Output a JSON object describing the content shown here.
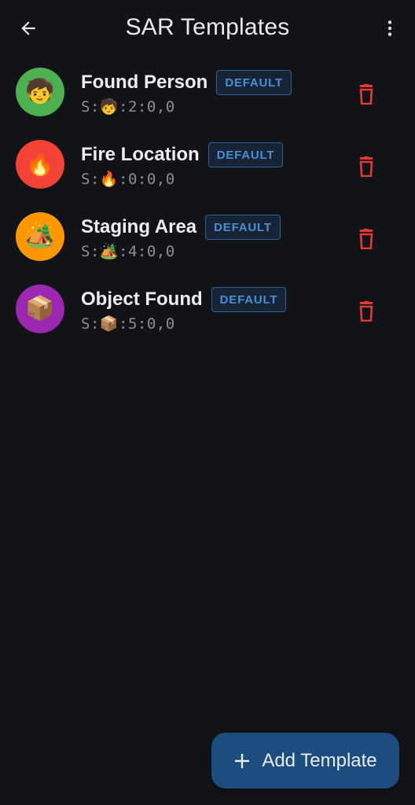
{
  "appbar": {
    "title": "SAR Templates",
    "back_icon": "arrow-left-icon",
    "more_icon": "more-vertical-icon"
  },
  "templates": [
    {
      "name": "Found Person",
      "badge": "DEFAULT",
      "code": "S:🧒:2:0,0",
      "emoji": "🧒",
      "color": "#4caf50",
      "delete_icon": "trash-icon"
    },
    {
      "name": "Fire Location",
      "badge": "DEFAULT",
      "code": "S:🔥:0:0,0",
      "emoji": "🔥",
      "color": "#f44336",
      "delete_icon": "trash-icon"
    },
    {
      "name": "Staging Area",
      "badge": "DEFAULT",
      "code": "S:🏕️:4:0,0",
      "emoji": "🏕️",
      "color": "#ff9800",
      "delete_icon": "trash-icon"
    },
    {
      "name": "Object Found",
      "badge": "DEFAULT",
      "code": "S:📦:5:0,0",
      "emoji": "📦",
      "color": "#9c27b0",
      "delete_icon": "trash-icon"
    }
  ],
  "fab": {
    "label": "Add Template",
    "icon": "plus-icon"
  },
  "colors": {
    "background": "#111317",
    "badge_text": "#4a8fd6",
    "delete": "#e53935",
    "fab": "#1d4c7e"
  }
}
